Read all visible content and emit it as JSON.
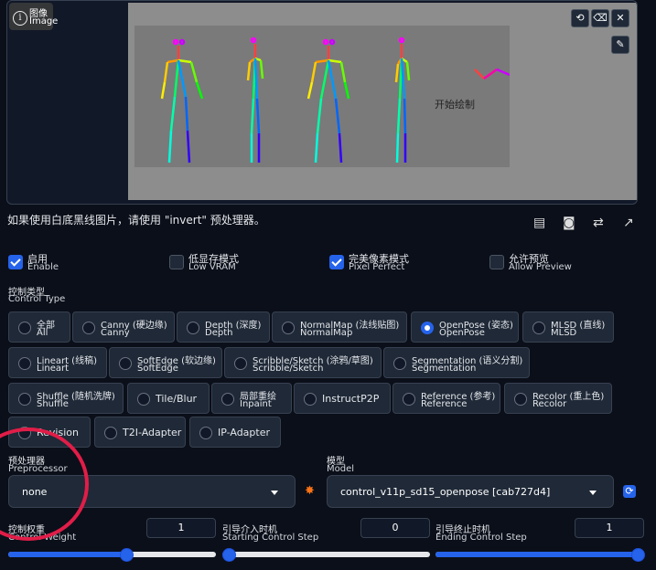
{
  "image_panel": {
    "label_cn": "图像",
    "label_en": "Image",
    "info_icon_glyph": "i",
    "canvas_hint": "开始绘制",
    "toolbar_icons": [
      "undo-icon",
      "eraser-icon",
      "close-icon",
      "brush-icon"
    ],
    "toolbar_glyphs": [
      "⟲",
      "⌫",
      "✕",
      "✎"
    ]
  },
  "hint": "如果使用白底黑线图片，请使用 \"invert\" 预处理器。",
  "action_icons": [
    "new-canvas-icon",
    "camera-icon",
    "swap-icon",
    "send-dimensions-icon"
  ],
  "action_glyphs": [
    "▤",
    "◙",
    "⇄",
    "↗"
  ],
  "checkboxes": [
    {
      "cn": "启用",
      "en": "Enable",
      "checked": true
    },
    {
      "cn": "低显存模式",
      "en": "Low VRAM",
      "checked": false
    },
    {
      "cn": "完美像素模式",
      "en": "Pixel Perfect",
      "checked": true
    },
    {
      "cn": "允许预览",
      "en": "Allow Preview",
      "checked": false
    }
  ],
  "control_type": {
    "label_cn": "控制类型",
    "label_en": "Control Type",
    "selected": "OpenPose (姿态)",
    "options": [
      {
        "l1": "全部",
        "l2": "All"
      },
      {
        "l1": "Canny (硬边缘)",
        "l2": "Canny"
      },
      {
        "l1": "Depth (深度)",
        "l2": "Depth"
      },
      {
        "l1": "NormalMap (法线贴图)",
        "l2": "NormalMap"
      },
      {
        "l1": "OpenPose (姿态)",
        "l2": "OpenPose"
      },
      {
        "l1": "MLSD (直线)",
        "l2": "MLSD"
      },
      {
        "l1": "Lineart (线稿)",
        "l2": "Lineart"
      },
      {
        "l1": "SoftEdge (软边缘)",
        "l2": "SoftEdge"
      },
      {
        "l1": "Scribble/Sketch (涂鸦/草图)",
        "l2": "Scribble/Sketch"
      },
      {
        "l1": "Segmentation (语义分割)",
        "l2": "Segmentation"
      },
      {
        "l1": "Shuffle (随机洗牌)",
        "l2": "Shuffle"
      },
      {
        "l1": "Tile/Blur",
        "l2": ""
      },
      {
        "l1": "局部重绘",
        "l2": "Inpaint"
      },
      {
        "l1": "InstructP2P",
        "l2": ""
      },
      {
        "l1": "Reference (参考)",
        "l2": "Reference"
      },
      {
        "l1": "Recolor (重上色)",
        "l2": "Recolor"
      },
      {
        "l1": "Revision",
        "l2": ""
      },
      {
        "l1": "T2I-Adapter",
        "l2": ""
      },
      {
        "l1": "IP-Adapter",
        "l2": ""
      }
    ]
  },
  "preprocessor": {
    "label_cn": "预处理器",
    "label_en": "Preprocessor",
    "value": "none",
    "run_icon": "explosion-icon",
    "run_glyph": "✸"
  },
  "model": {
    "label_cn": "模型",
    "label_en": "Model",
    "value": "control_v11p_sd15_openpose [cab727d4]",
    "refresh_icon": "refresh-icon",
    "refresh_glyph": "⟳"
  },
  "sliders": [
    {
      "cn": "控制权重",
      "en": "Control Weight",
      "value": "1",
      "fraction": 0.57
    },
    {
      "cn": "引导介入时机",
      "en": "Starting Control Step",
      "value": "0",
      "fraction": 0.0
    },
    {
      "cn": "引导终止时机",
      "en": "Ending Control Step",
      "value": "1",
      "fraction": 1.0
    }
  ]
}
